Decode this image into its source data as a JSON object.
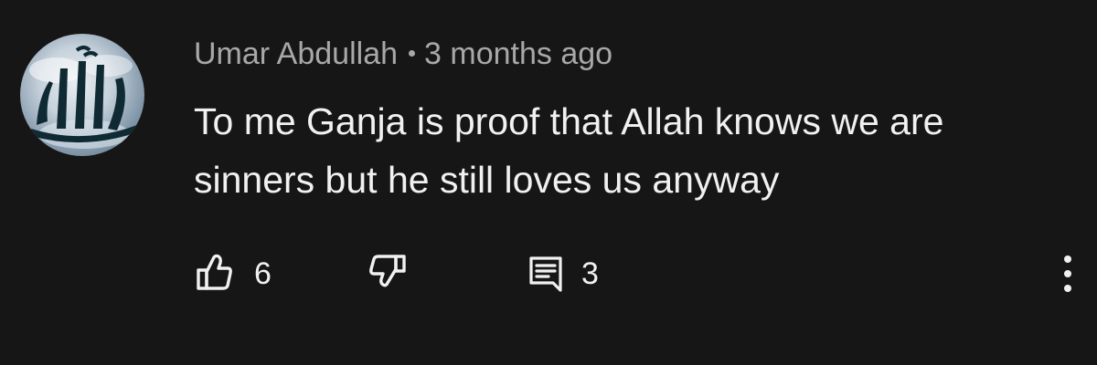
{
  "comment": {
    "author": "Umar Abdullah",
    "time_ago": "3 months ago",
    "text": "To me Ganja is proof that Allah knows we are sinners but he still loves us anyway",
    "avatar_icon": "allah-calligraphy-avatar"
  },
  "actions": {
    "like_icon": "thumbs-up-icon",
    "like_count": "6",
    "dislike_icon": "thumbs-down-icon",
    "reply_icon": "comment-icon",
    "reply_count": "3",
    "more_icon": "more-vertical-icon"
  },
  "colors": {
    "background": "#161616",
    "text_primary": "#f1f1f1",
    "text_secondary": "#a8a8a8"
  }
}
